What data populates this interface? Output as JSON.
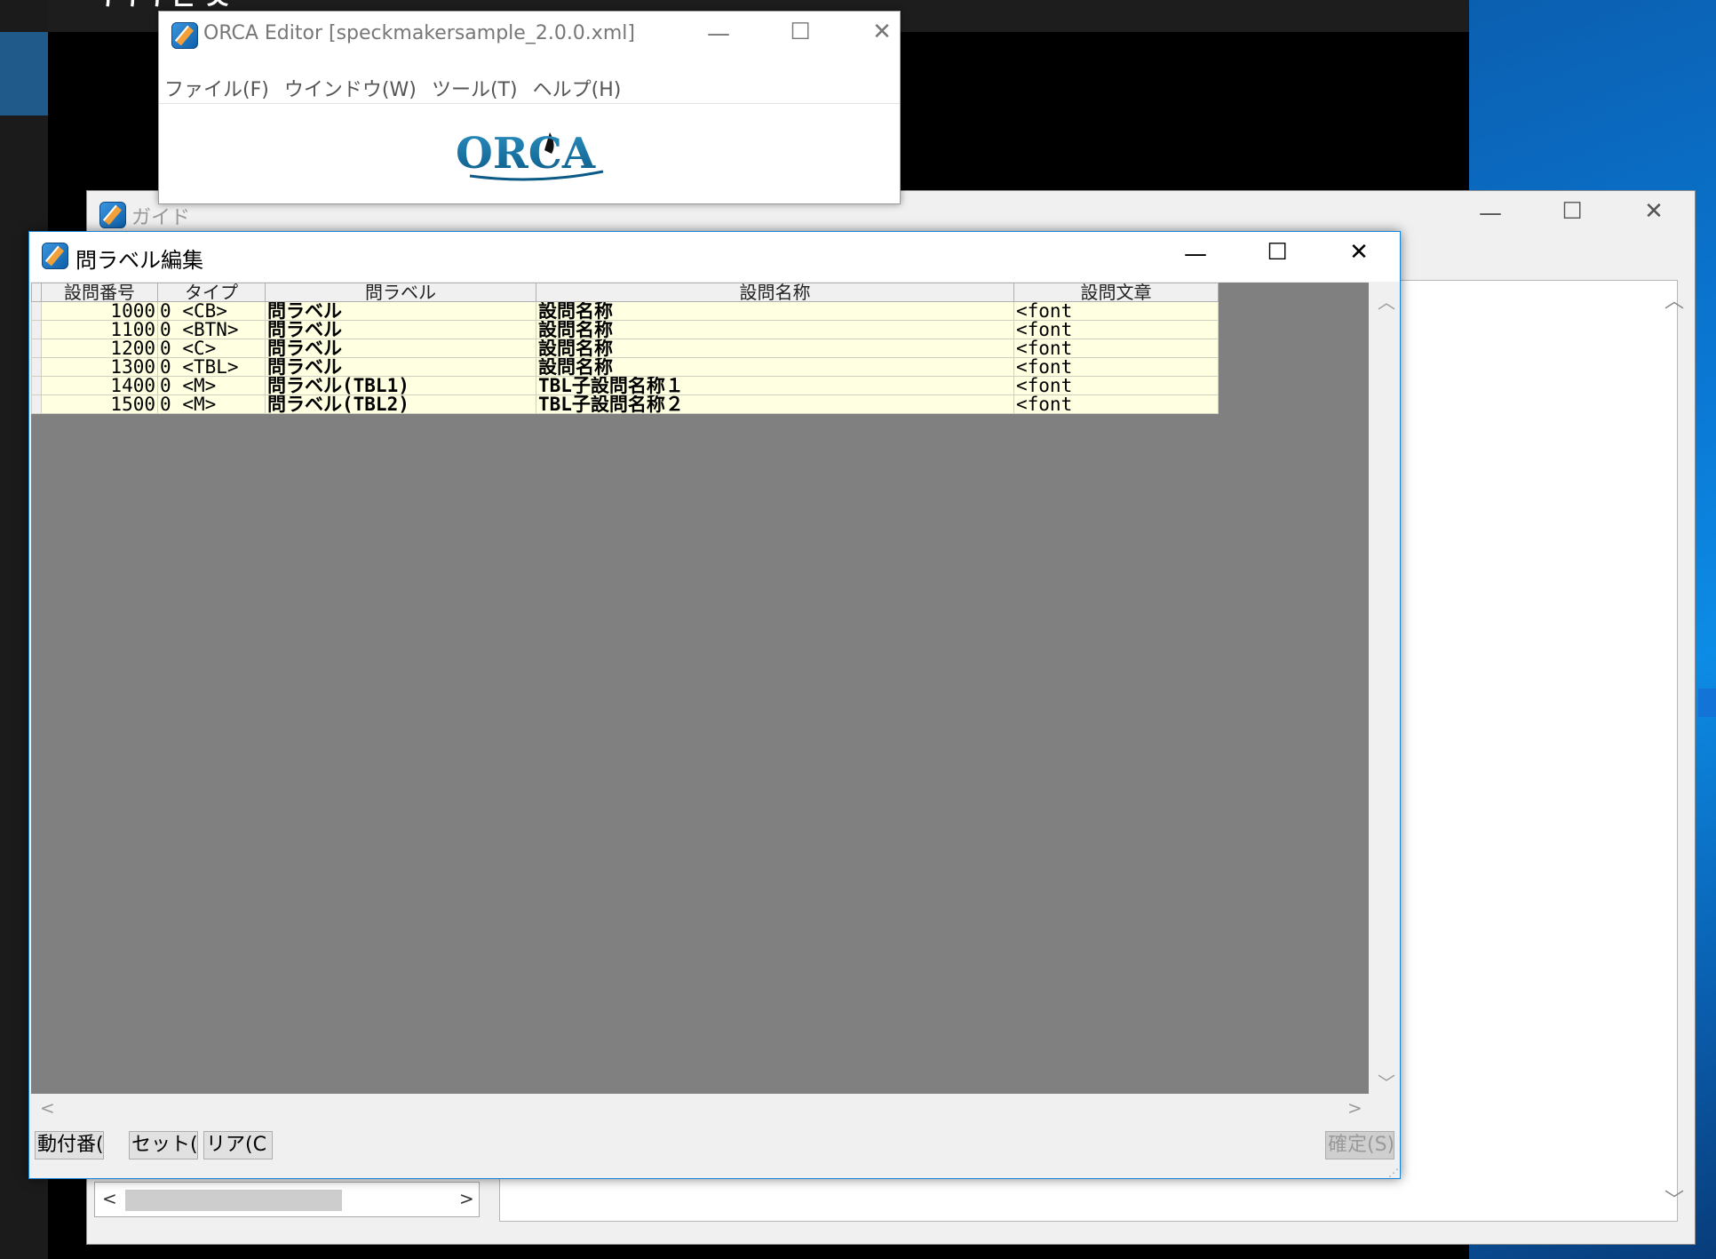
{
  "desktop": {
    "top_bar_text": "ᄀᄀᄀ ᄂ ᄉ"
  },
  "guide_window": {
    "title": "ガイド",
    "controls": {
      "minimize": "—",
      "maximize": "☐",
      "close": "✕"
    },
    "scroll_up": "︿",
    "scroll_down": "﹀",
    "hscroll_left": "<",
    "hscroll_right": ">"
  },
  "orca_window": {
    "title": "ORCA Editor [speckmakersample_2.0.0.xml]",
    "menu": [
      "ファイル(F)",
      "ウインドウ(W)",
      "ツール(T)",
      "ヘルプ(H)"
    ],
    "logo_text": "ORCA",
    "controls": {
      "minimize": "—",
      "maximize": "☐",
      "close": "✕"
    }
  },
  "label_window": {
    "title": "問ラベル編集",
    "controls": {
      "minimize": "—",
      "maximize": "☐",
      "close": "✕"
    },
    "columns": [
      "設問番号",
      "タイプ",
      "問ラベル",
      "設問名称",
      "設問文章"
    ],
    "rows": [
      {
        "num": "1000",
        "flag": "0",
        "type": "<CB>",
        "label": "問ラベル",
        "name": "設問名称",
        "text": "<font"
      },
      {
        "num": "1100",
        "flag": "0",
        "type": "<BTN>",
        "label": "問ラベル",
        "name": "設問名称",
        "text": "<font"
      },
      {
        "num": "1200",
        "flag": "0",
        "type": "<C>",
        "label": "問ラベル",
        "name": "設問名称",
        "text": "<font"
      },
      {
        "num": "1300",
        "flag": "0",
        "type": "<TBL>",
        "label": "問ラベル",
        "name": "設問名称",
        "text": "<font"
      },
      {
        "num": "1400",
        "flag": "0",
        "type": "<M>",
        "label": "問ラベル(TBL1)",
        "name": "TBL子設問名称１",
        "text": "<font"
      },
      {
        "num": "1500",
        "flag": "0",
        "type": "<M>",
        "label": "問ラベル(TBL2)",
        "name": "TBL子設問名称２",
        "text": "<font"
      }
    ],
    "scroll_up": "︿",
    "scroll_down": "﹀",
    "hscroll_left": "<",
    "hscroll_right": ">",
    "buttons": {
      "auto_number": "動付番(",
      "set": "セット(",
      "clear": "リア(C",
      "confirm": "確定(S)"
    },
    "resize_grip": "⋰"
  }
}
